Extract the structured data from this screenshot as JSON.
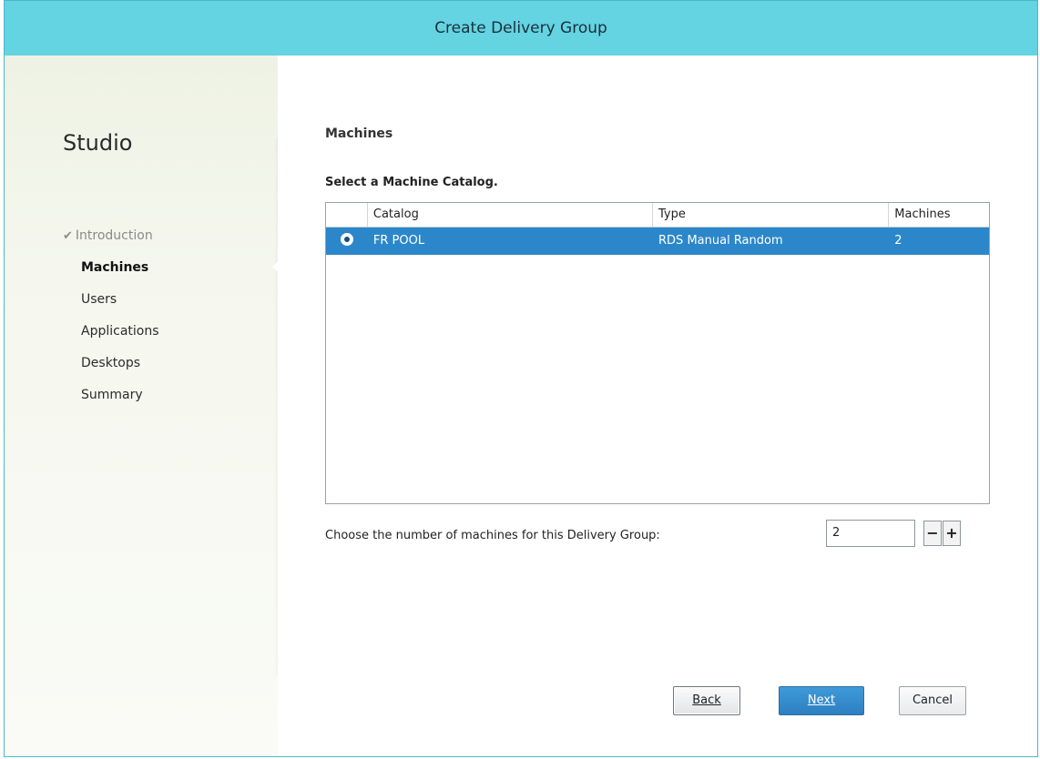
{
  "window": {
    "title": "Create Delivery Group"
  },
  "sidebar": {
    "brand": "Studio",
    "steps": [
      {
        "label": "Introduction",
        "state": "done",
        "icon": "check-icon"
      },
      {
        "label": "Machines",
        "state": "current"
      },
      {
        "label": "Users",
        "state": "pending"
      },
      {
        "label": "Applications",
        "state": "pending"
      },
      {
        "label": "Desktops",
        "state": "pending"
      },
      {
        "label": "Summary",
        "state": "pending"
      }
    ]
  },
  "main": {
    "section_title": "Machines",
    "subheading": "Select a Machine Catalog.",
    "table": {
      "columns": [
        "",
        "Catalog",
        "Type",
        "Machines"
      ],
      "rows": [
        {
          "selected": true,
          "catalog": "FR POOL",
          "type": "RDS Manual Random",
          "machines": "2"
        }
      ]
    },
    "machine_count": {
      "label": "Choose the number of machines for this Delivery Group:",
      "value": "2",
      "minus": "−",
      "plus": "+"
    }
  },
  "buttons": {
    "back": "Back",
    "next": "Next",
    "cancel": "Cancel"
  },
  "colors": {
    "title_bar": "#64d3e2",
    "selection": "#2b87c9",
    "primary_button": "#3f9ad9"
  }
}
